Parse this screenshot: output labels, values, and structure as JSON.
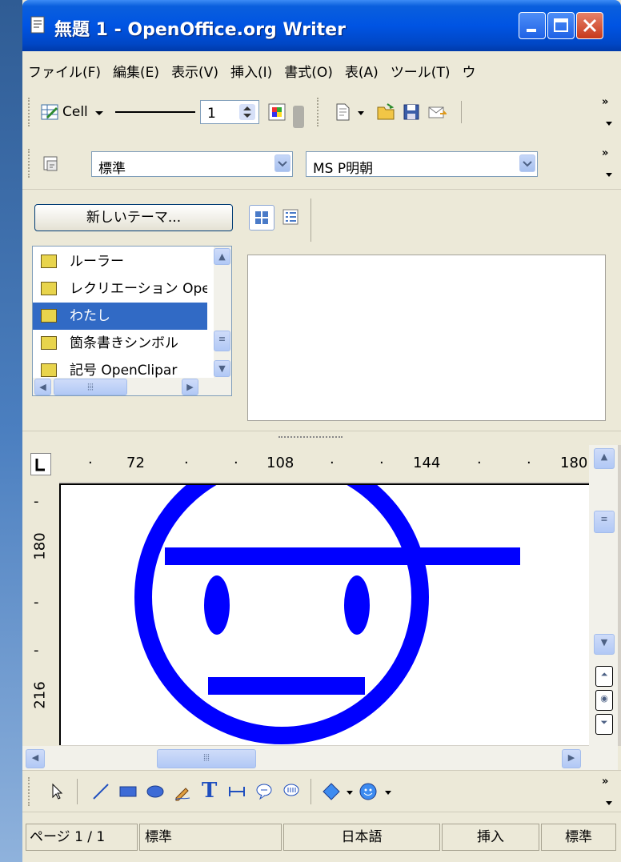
{
  "window": {
    "title": "無題 1 - OpenOffice.org Writer"
  },
  "menu": {
    "items": [
      "ファイル(F)",
      "編集(E)",
      "表示(V)",
      "挿入(I)",
      "書式(O)",
      "表(A)",
      "ツール(T)",
      "ウ"
    ]
  },
  "toolbar_table": {
    "cell_label": "Cell",
    "line_width": "1"
  },
  "toolbar_format": {
    "style": "標準",
    "font": "MS P明朝"
  },
  "gallery": {
    "new_theme_button": "新しいテーマ...",
    "themes": [
      {
        "label": "ルーラー",
        "selected": false
      },
      {
        "label": "レクリエーション Ope",
        "selected": false
      },
      {
        "label": "わたし",
        "selected": true
      },
      {
        "label": "箇条書きシンボル",
        "selected": false
      },
      {
        "label": "記号 OpenClipar",
        "selected": false
      }
    ]
  },
  "ruler": {
    "horizontal": [
      "72",
      "108",
      "144",
      "180"
    ],
    "vertical": [
      "180",
      "216"
    ]
  },
  "status": {
    "page": "ページ 1 / 1",
    "style": "標準",
    "language": "日本語",
    "mode": "挿入",
    "selection": "標準"
  },
  "colors": {
    "drawing": "#0000ff",
    "selection": "#316ac5",
    "titlebar": "#0054e3"
  }
}
